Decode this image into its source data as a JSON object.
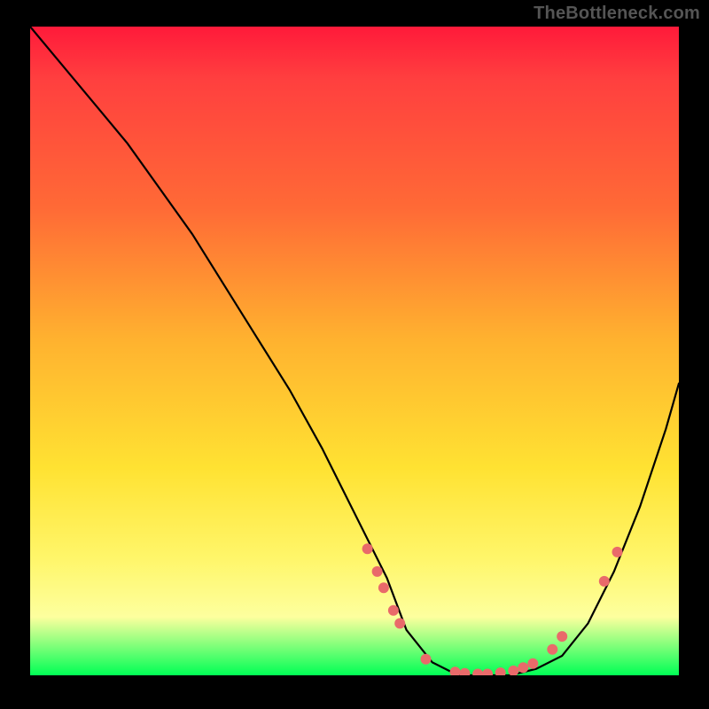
{
  "watermark": "TheBottleneck.com",
  "chart_data": {
    "type": "line",
    "title": "",
    "xlabel": "",
    "ylabel": "",
    "xlim": [
      0,
      100
    ],
    "ylim": [
      0,
      100
    ],
    "series": [
      {
        "name": "curve",
        "x": [
          0,
          5,
          10,
          15,
          20,
          25,
          30,
          35,
          40,
          45,
          50,
          55,
          58,
          62,
          66,
          70,
          74,
          78,
          82,
          86,
          90,
          94,
          98,
          100
        ],
        "y": [
          100,
          94,
          88,
          82,
          75,
          68,
          60,
          52,
          44,
          35,
          25,
          15,
          7,
          2,
          0,
          0,
          0,
          1,
          3,
          8,
          16,
          26,
          38,
          45
        ]
      }
    ],
    "data_points": [
      {
        "x": 52.0,
        "y": 19.5
      },
      {
        "x": 53.5,
        "y": 16.0
      },
      {
        "x": 54.5,
        "y": 13.5
      },
      {
        "x": 56.0,
        "y": 10.0
      },
      {
        "x": 57.0,
        "y": 8.0
      },
      {
        "x": 61.0,
        "y": 2.5
      },
      {
        "x": 65.5,
        "y": 0.5
      },
      {
        "x": 67.0,
        "y": 0.3
      },
      {
        "x": 69.0,
        "y": 0.2
      },
      {
        "x": 70.5,
        "y": 0.2
      },
      {
        "x": 72.5,
        "y": 0.4
      },
      {
        "x": 74.5,
        "y": 0.7
      },
      {
        "x": 76.0,
        "y": 1.2
      },
      {
        "x": 77.5,
        "y": 1.8
      },
      {
        "x": 80.5,
        "y": 4.0
      },
      {
        "x": 82.0,
        "y": 6.0
      },
      {
        "x": 88.5,
        "y": 14.5
      },
      {
        "x": 90.5,
        "y": 19.0
      }
    ],
    "gradient_colors": {
      "top": "#ff1a3a",
      "mid1": "#ff6a36",
      "mid2": "#ffe232",
      "mid3": "#fdff9e",
      "bottom": "#00ff55"
    }
  }
}
